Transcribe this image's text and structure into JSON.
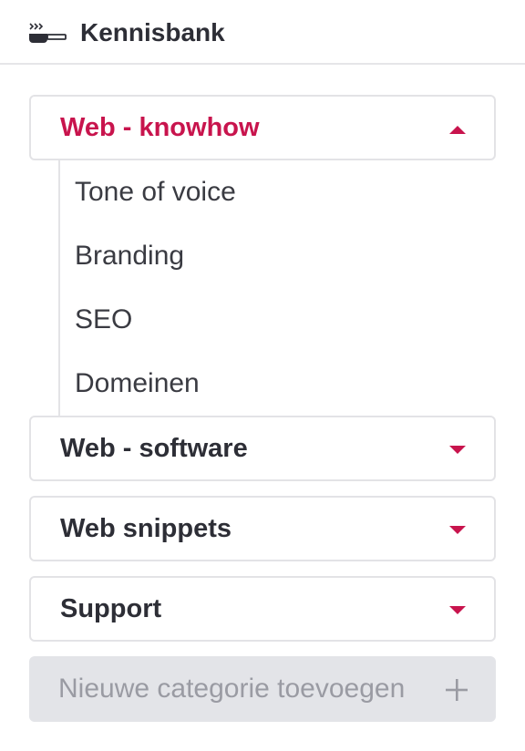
{
  "header": {
    "title": "Kennisbank",
    "icon": "cooking-pot-icon"
  },
  "categories": [
    {
      "label": "Web - knowhow",
      "expanded": true,
      "items": [
        "Tone of voice",
        "Branding",
        "SEO",
        "Domeinen"
      ]
    },
    {
      "label": "Web - software",
      "expanded": false
    },
    {
      "label": "Web snippets",
      "expanded": false
    },
    {
      "label": "Support",
      "expanded": false
    }
  ],
  "add_category": {
    "label": "Nieuwe categorie toevoegen",
    "icon": "plus-icon"
  },
  "colors": {
    "accent": "#c8144d",
    "text": "#2d2e36",
    "border": "#e3e3e6",
    "button_bg": "#e3e4e8",
    "button_text": "#9a9ba3"
  }
}
